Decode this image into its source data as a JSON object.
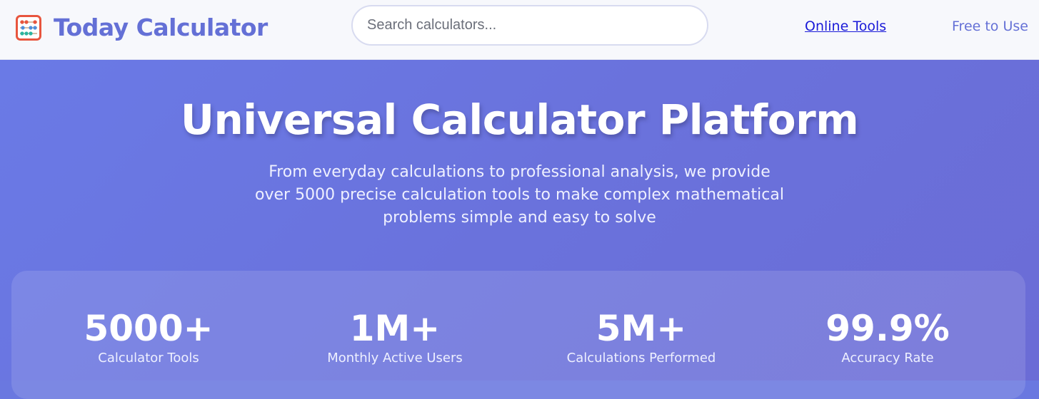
{
  "header": {
    "brand": "Today Calculator",
    "logo_icon": "abacus-icon",
    "search_placeholder": "Search calculators...",
    "nav": [
      "Online Tools",
      "Free to Use"
    ]
  },
  "hero": {
    "title": "Universal Calculator Platform",
    "subtitle": "From everyday calculations to professional analysis, we provide over 5000 precise calculation tools to make complex mathematical problems simple and easy to solve"
  },
  "stats": [
    {
      "value": "5000+",
      "label": "Calculator Tools"
    },
    {
      "value": "1M+",
      "label": "Monthly Active Users"
    },
    {
      "value": "5M+",
      "label": "Calculations Performed"
    },
    {
      "value": "99.9%",
      "label": "Accuracy Rate"
    }
  ],
  "colors": {
    "brand": "#6470d6",
    "hero_bg": "#6a78e0",
    "link": "#1a1ad8"
  }
}
